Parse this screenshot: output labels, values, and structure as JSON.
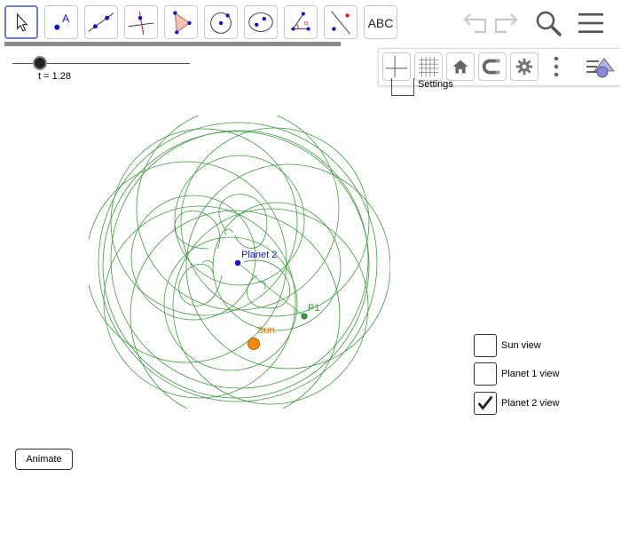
{
  "toolbar": {
    "tools": [
      "move-tool",
      "point-tool",
      "line-tool",
      "perpendicular-line-tool",
      "polygon-tool",
      "circle-tool",
      "conic-tool",
      "angle-tool",
      "reflect-tool",
      "text-tool"
    ],
    "text_tool_label": "ABC",
    "right_icons": [
      "undo-icon",
      "redo-icon",
      "search-icon",
      "menu-icon"
    ]
  },
  "style_bar": {
    "buttons": [
      "axes-icon",
      "grid-icon",
      "home-icon",
      "magnet-icon",
      "gear-icon",
      "more-icon",
      "style-bar-toggle-icon"
    ]
  },
  "slider": {
    "label": "t = 1.28",
    "value": 1.28,
    "position_fraction": 0.155
  },
  "settings": {
    "label": "Settings"
  },
  "graph": {
    "labels": {
      "planet2": "Planet 2",
      "p1": "P1",
      "sun": "Sun"
    },
    "colors": {
      "orbit": "#3f9a3f",
      "planet2": "#1515cc",
      "p1": "#3f9a3f",
      "sun": "#ff8800",
      "sun_label": "#e07000"
    }
  },
  "checkboxes": [
    {
      "label": "Sun view",
      "checked": false
    },
    {
      "label": "Planet 1 view",
      "checked": false
    },
    {
      "label": "Planet 2 view",
      "checked": true
    }
  ],
  "animate_button": {
    "label": "Animate"
  }
}
